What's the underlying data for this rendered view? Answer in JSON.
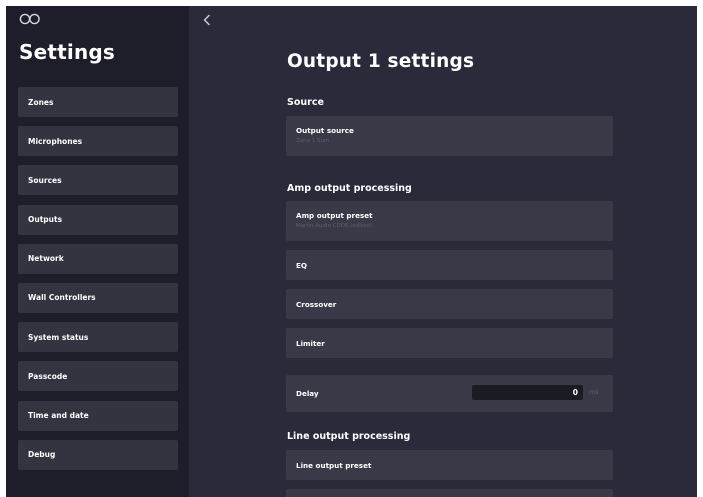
{
  "sidebar": {
    "title": "Settings",
    "items": [
      {
        "label": "Zones"
      },
      {
        "label": "Microphones"
      },
      {
        "label": "Sources"
      },
      {
        "label": "Outputs"
      },
      {
        "label": "Network"
      },
      {
        "label": "Wall Controllers"
      },
      {
        "label": "System status"
      },
      {
        "label": "Passcode"
      },
      {
        "label": "Time and date"
      },
      {
        "label": "Debug"
      }
    ]
  },
  "main": {
    "title": "Output 1 settings",
    "source": {
      "heading": "Source",
      "output_source": {
        "label": "Output source",
        "value": "Zone 1 Sum"
      }
    },
    "amp": {
      "heading": "Amp output processing",
      "preset": {
        "label": "Amp output preset",
        "value": "Martin Audio CDD6 (edited)"
      },
      "eq": {
        "label": "EQ"
      },
      "crossover": {
        "label": "Crossover"
      },
      "limiter": {
        "label": "Limiter"
      },
      "delay": {
        "label": "Delay",
        "value": "0",
        "unit": "ms"
      }
    },
    "line": {
      "heading": "Line output processing",
      "preset": {
        "label": "Line output preset"
      }
    }
  },
  "colors": {
    "sidebar_bg": "#1d1e2a",
    "main_bg": "#2a2b3a",
    "card_bg": "#393a47",
    "nav_item_bg": "#33343f",
    "input_bg": "#1a1b23",
    "muted_text": "#5d5e6c"
  }
}
